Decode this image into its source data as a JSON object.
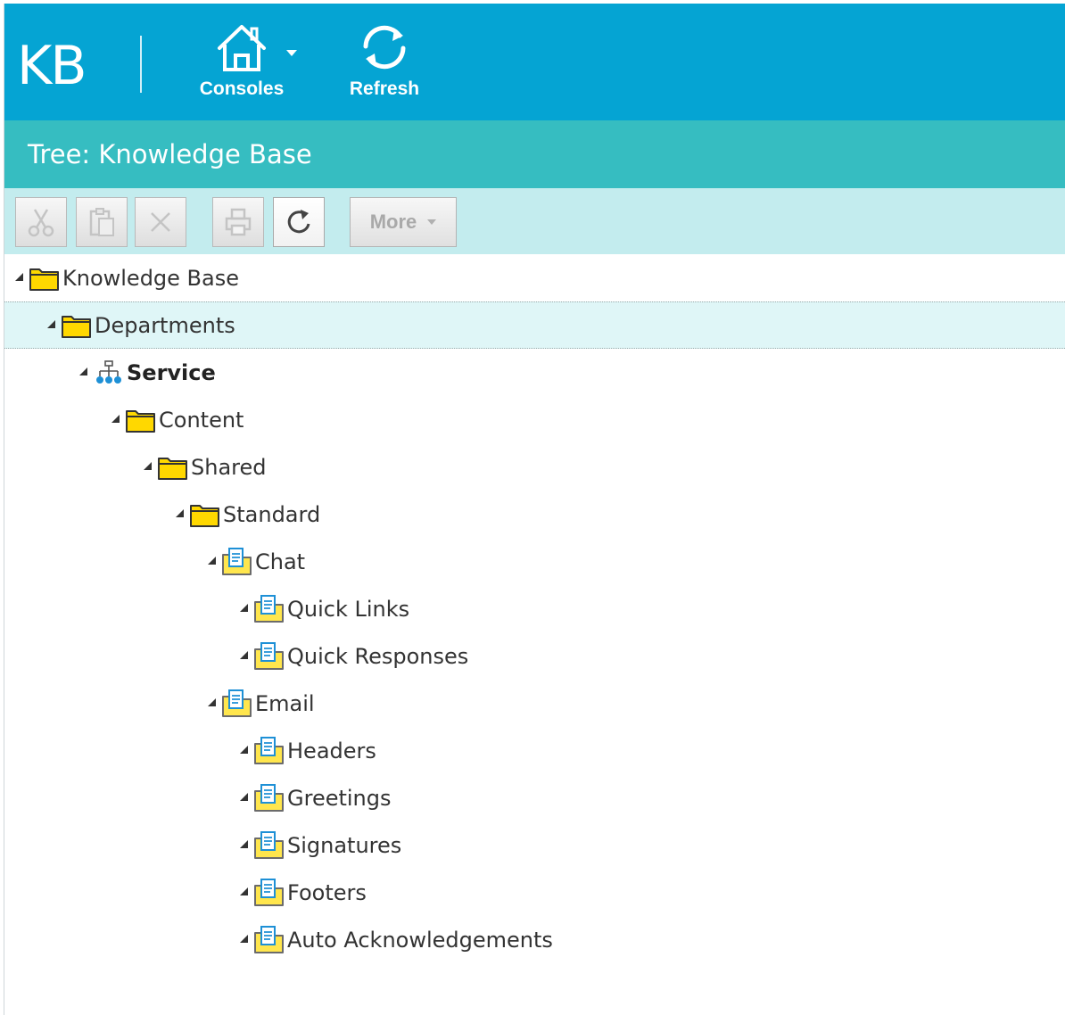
{
  "header": {
    "app_logo": "KB",
    "consoles_label": "Consoles",
    "refresh_label": "Refresh"
  },
  "title": "Tree: Knowledge Base",
  "toolbar": {
    "more_label": "More"
  },
  "tree": [
    {
      "label": "Knowledge Base",
      "icon": "folder",
      "level": 0
    },
    {
      "label": "Departments",
      "icon": "folder",
      "level": 1,
      "selected": true
    },
    {
      "label": "Service",
      "icon": "department",
      "level": 2,
      "bold": true
    },
    {
      "label": "Content",
      "icon": "folder",
      "level": 3
    },
    {
      "label": "Shared",
      "icon": "folder",
      "level": 4
    },
    {
      "label": "Standard",
      "icon": "folder",
      "level": 5
    },
    {
      "label": "Chat",
      "icon": "article-folder",
      "level": 6
    },
    {
      "label": "Quick Links",
      "icon": "article-folder",
      "level": 7
    },
    {
      "label": "Quick Responses",
      "icon": "article-folder",
      "level": 7
    },
    {
      "label": "Email",
      "icon": "article-folder",
      "level": 6
    },
    {
      "label": "Headers",
      "icon": "article-folder",
      "level": 7
    },
    {
      "label": "Greetings",
      "icon": "article-folder",
      "level": 7
    },
    {
      "label": "Signatures",
      "icon": "article-folder",
      "level": 7
    },
    {
      "label": "Footers",
      "icon": "article-folder",
      "level": 7
    },
    {
      "label": "Auto Acknowledgements",
      "icon": "article-folder",
      "level": 7
    }
  ],
  "colors": {
    "header_bg": "#05a4d3",
    "title_bg": "#36bdc1",
    "toolbar_bg": "#c3ecee",
    "folder_yellow": "#ffd800"
  }
}
